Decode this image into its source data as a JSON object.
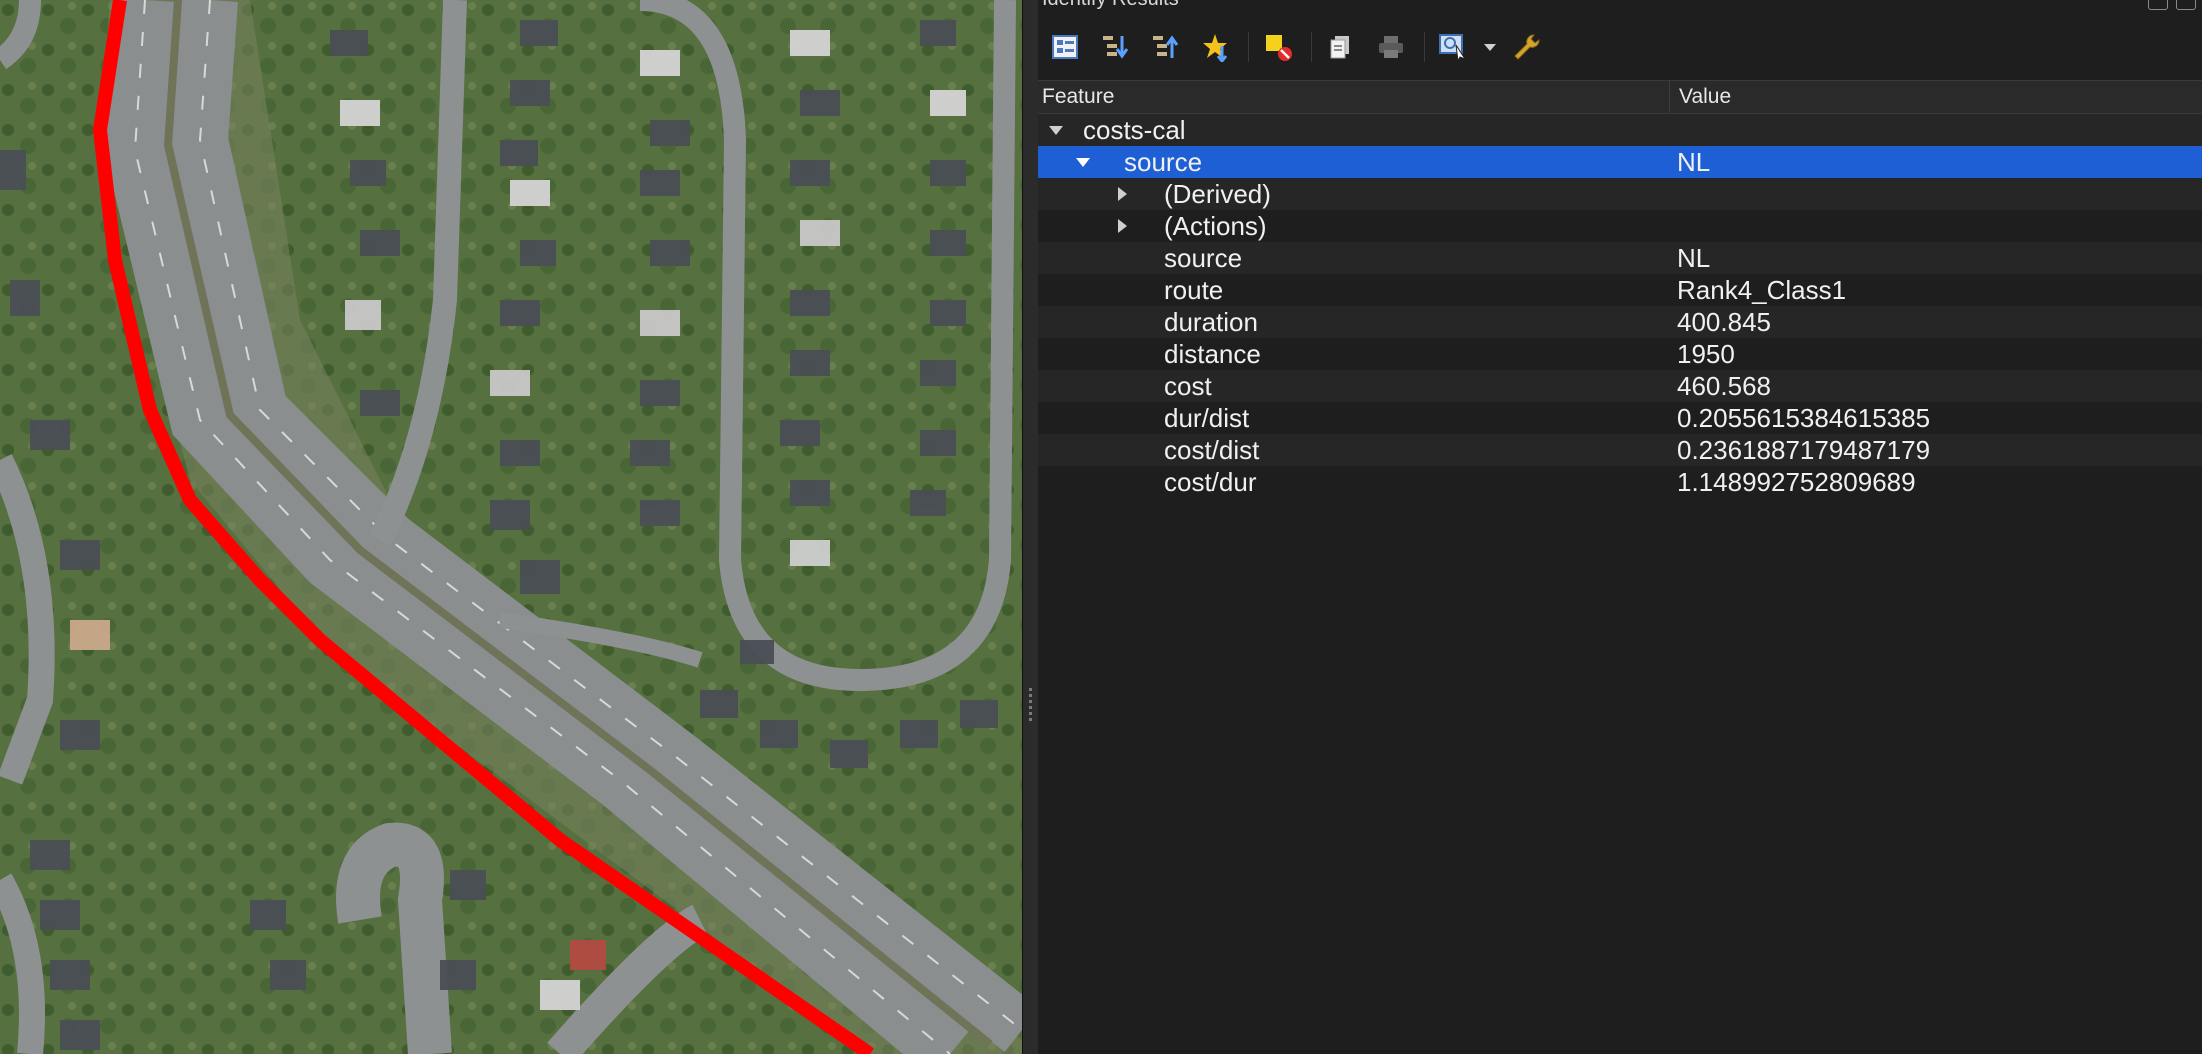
{
  "panel": {
    "title": "Identify Results",
    "toolbar": [
      {
        "name": "expand-tree-icon"
      },
      {
        "name": "expand-all-icon"
      },
      {
        "name": "collapse-all-icon"
      },
      {
        "name": "expand-new-icon"
      },
      {
        "name": "clear-highlights-icon"
      },
      {
        "name": "copy-icon"
      },
      {
        "name": "print-icon"
      },
      {
        "name": "identify-mode-icon"
      },
      {
        "name": "dropdown-arrow-icon"
      },
      {
        "name": "settings-wrench-icon"
      }
    ],
    "columns": {
      "feature": "Feature",
      "value": "Value"
    }
  },
  "tree": {
    "layer": {
      "label": "costs-cal",
      "expanded": true
    },
    "feature": {
      "label": "source",
      "value": "NL",
      "expanded": true,
      "selected": true
    },
    "groups": [
      {
        "label": "(Derived)",
        "expanded": false
      },
      {
        "label": "(Actions)",
        "expanded": false
      }
    ],
    "attributes": [
      {
        "label": "source",
        "value": "NL"
      },
      {
        "label": "route",
        "value": "Rank4_Class1"
      },
      {
        "label": "duration",
        "value": "400.845"
      },
      {
        "label": "distance",
        "value": "1950"
      },
      {
        "label": "cost",
        "value": "460.568"
      },
      {
        "label": "dur/dist",
        "value": "0.2055615384615385"
      },
      {
        "label": "cost/dist",
        "value": "0.2361887179487179"
      },
      {
        "label": "cost/dur",
        "value": "1.148992752809689"
      }
    ]
  },
  "map": {
    "route_color": "#ff0000",
    "road_color": "#8e9192",
    "vegetation_color": "#4f6a3c"
  }
}
